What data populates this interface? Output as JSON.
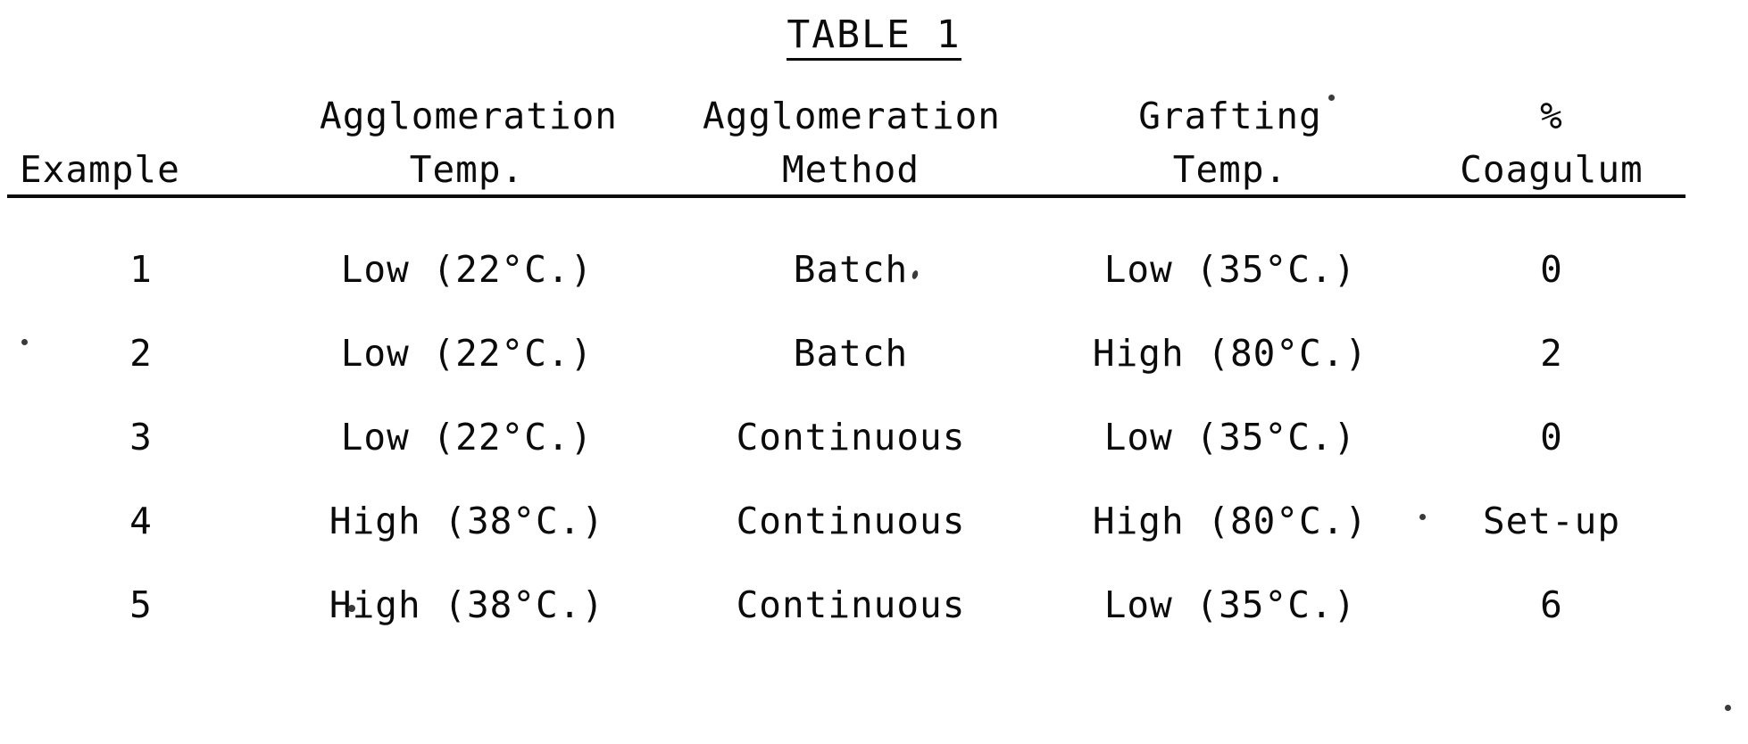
{
  "document": {
    "title": "TABLE 1"
  },
  "table": {
    "headers": [
      {
        "line1": "",
        "line2": "Example"
      },
      {
        "line1": "Agglomeration",
        "line2": "Temp."
      },
      {
        "line1": "Agglomeration",
        "line2": "Method"
      },
      {
        "line1": "Grafting",
        "line2": "Temp."
      },
      {
        "line1": "%",
        "line2": "Coagulum"
      }
    ],
    "rows": [
      {
        "example": "1",
        "agglomeration_temp": "Low (22°C.)",
        "agglomeration_method": "Batch",
        "grafting_temp": "Low (35°C.)",
        "coagulum": "0"
      },
      {
        "example": "2",
        "agglomeration_temp": "Low (22°C.)",
        "agglomeration_method": "Batch",
        "grafting_temp": "High (80°C.)",
        "coagulum": "2"
      },
      {
        "example": "3",
        "agglomeration_temp": "Low (22°C.)",
        "agglomeration_method": "Continuous",
        "grafting_temp": "Low (35°C.)",
        "coagulum": "0"
      },
      {
        "example": "4",
        "agglomeration_temp": "High (38°C.)",
        "agglomeration_method": "Continuous",
        "grafting_temp": "High (80°C.)",
        "coagulum": "Set-up"
      },
      {
        "example": "5",
        "agglomeration_temp": "High (38°C.)",
        "agglomeration_method": "Continuous",
        "grafting_temp": "Low (35°C.)",
        "coagulum": "6"
      }
    ]
  },
  "colors": {
    "ink": "#0b0b0b",
    "paper": "#ffffff"
  }
}
